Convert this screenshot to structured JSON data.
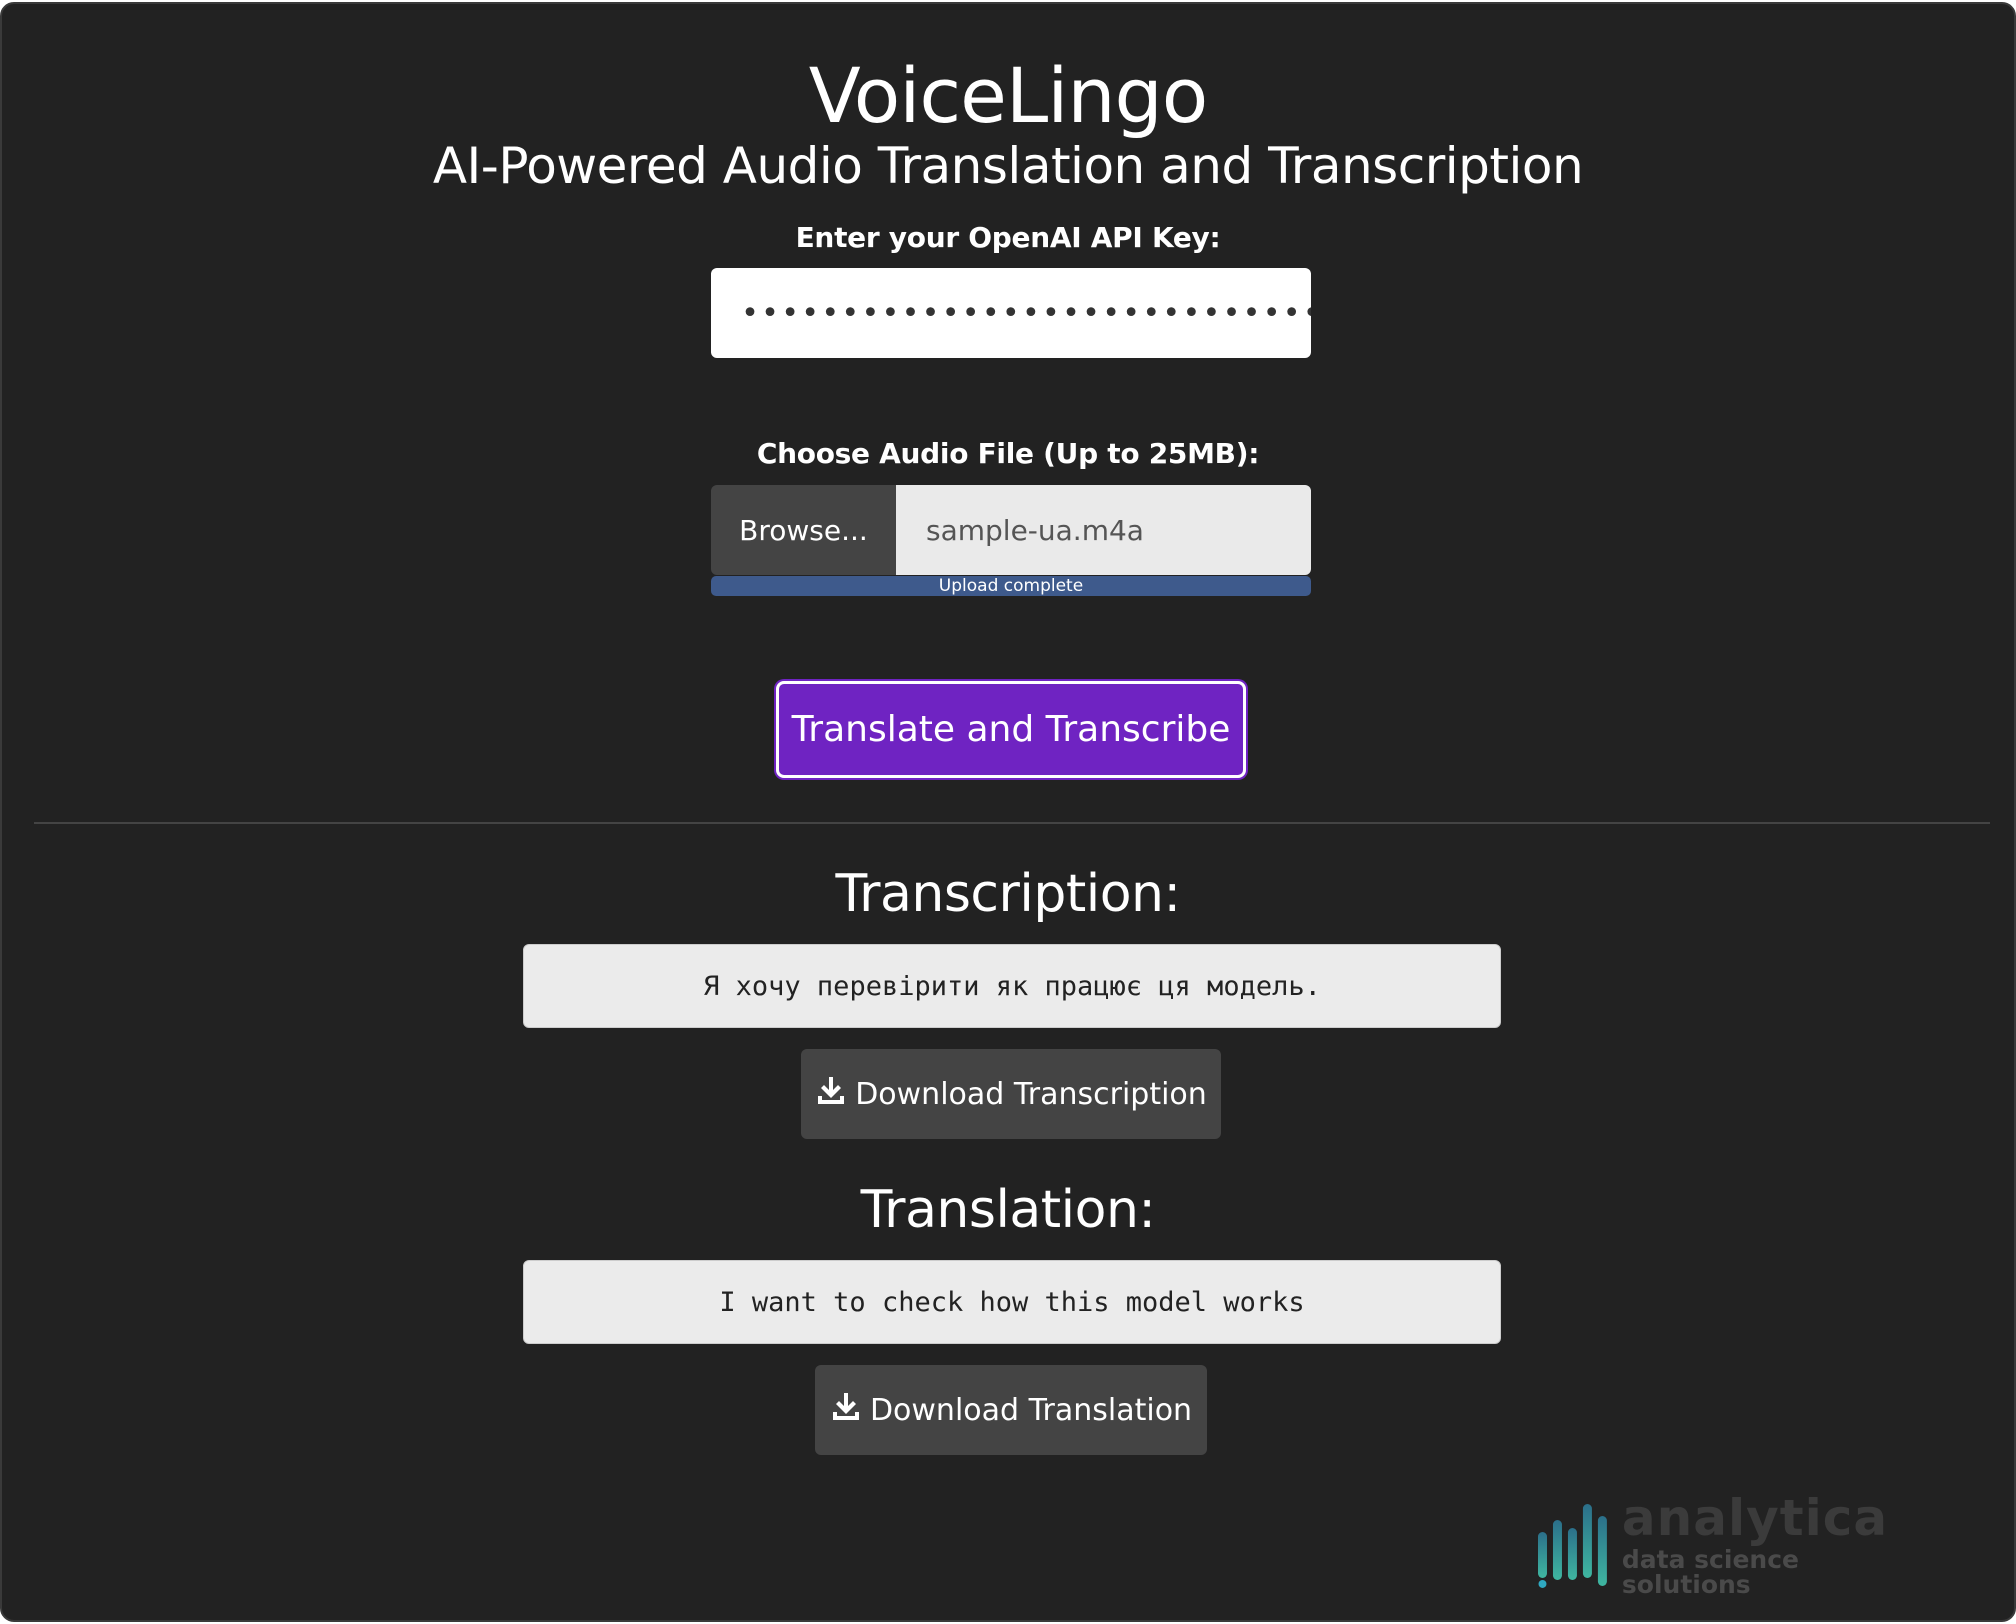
{
  "app": {
    "title": "VoiceLingo",
    "subtitle": "AI-Powered Audio Translation and Transcription"
  },
  "api_key": {
    "label": "Enter your OpenAI API Key:",
    "masked_value": "••••••••••••••••••••••••••••••••"
  },
  "audio_file": {
    "label": "Choose Audio File (Up to 25MB):",
    "browse_label": "Browse...",
    "file_name": "sample-ua.m4a",
    "progress_text": "Upload complete",
    "progress": 1.0
  },
  "actions": {
    "translate_label": "Translate and Transcribe"
  },
  "transcription": {
    "heading": "Transcription:",
    "text": "Я хочу перевірити як працює ця модель.",
    "download_label": "Download Transcription"
  },
  "translation": {
    "heading": "Translation:",
    "text": "I want to check how this model works",
    "download_label": "Download Translation"
  },
  "logo": {
    "word": "analytica",
    "tagline": "data science solutions"
  },
  "colors": {
    "background": "#222222",
    "accent": "#6f23c2",
    "progress": "#3e5a8c"
  }
}
